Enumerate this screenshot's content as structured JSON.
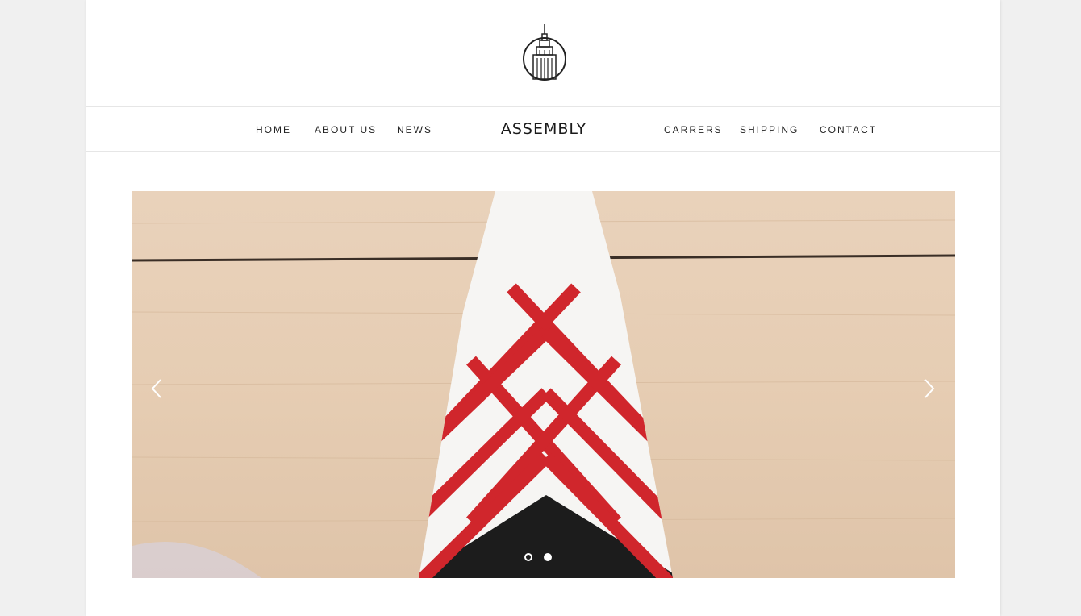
{
  "brand": {
    "logo_icon": "empire-state-building-icon",
    "name": "ASSEMBLY"
  },
  "nav": {
    "left": [
      "HOME",
      "ABOUT US",
      "NEWS"
    ],
    "right": [
      "CARRERS",
      "SHIPPING",
      "CONTACT"
    ]
  },
  "slider": {
    "prev_icon": "chevron-left-icon",
    "next_icon": "chevron-right-icon",
    "slide_count": 2,
    "active_slide": 2
  },
  "colors": {
    "accent_red": "#d0262c",
    "background": "#f0f0f0",
    "text": "#222222"
  }
}
